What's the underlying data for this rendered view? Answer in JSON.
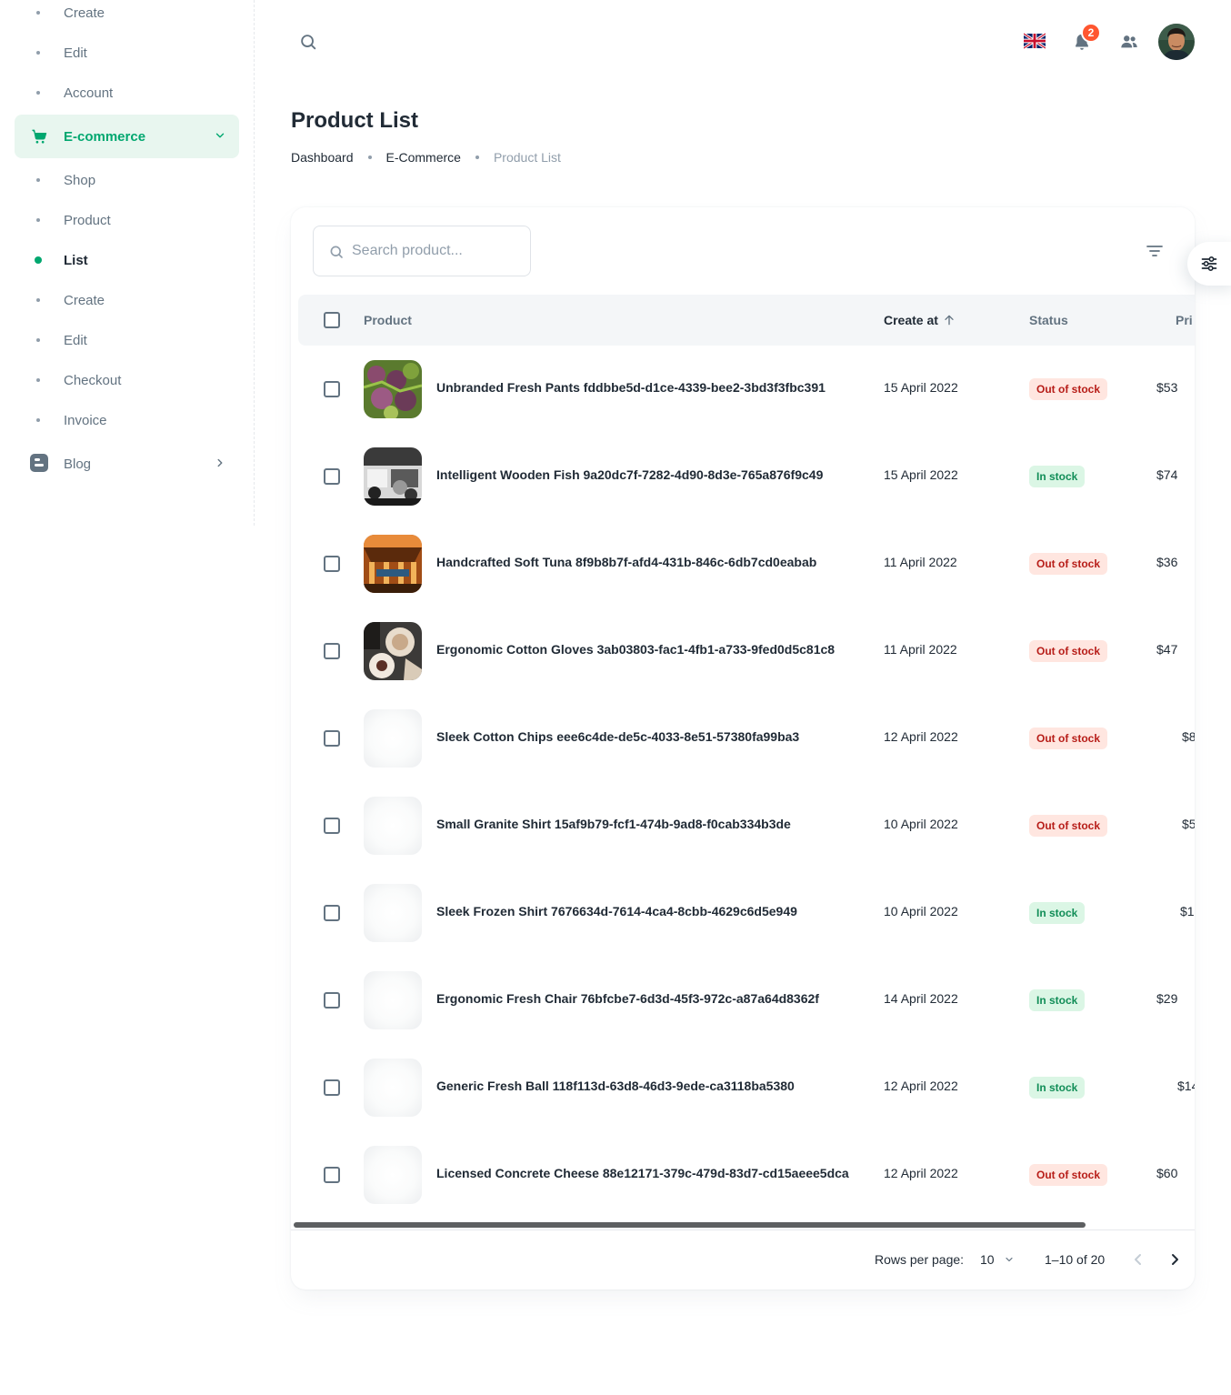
{
  "sidebar": {
    "items_top": [
      "Create",
      "Edit",
      "Account"
    ],
    "ecommerce_label": "E-commerce",
    "ecommerce_children": [
      "Shop",
      "Product",
      "List",
      "Create",
      "Edit",
      "Checkout",
      "Invoice"
    ],
    "active_child": "List",
    "blog_label": "Blog"
  },
  "header": {
    "notification_count": "2",
    "language": "English",
    "icons": [
      "search-icon",
      "uk-flag-icon",
      "bell-icon",
      "contacts-icon",
      "avatar"
    ]
  },
  "page": {
    "title": "Product List",
    "breadcrumb": [
      "Dashboard",
      "E-Commerce",
      "Product List"
    ]
  },
  "toolbar": {
    "search_placeholder": "Search product..."
  },
  "table": {
    "columns": [
      "Product",
      "Create at",
      "Status",
      "Pri"
    ],
    "rows": [
      {
        "name": "Unbranded Fresh Pants fddbbe5d-d1ce-4339-bee2-3bd3f3fbc391",
        "date": "15 April 2022",
        "status": "Out of stock",
        "price": "$53",
        "image": "photo"
      },
      {
        "name": "Intelligent Wooden Fish 9a20dc7f-7282-4d90-8d3e-765a876f9c49",
        "date": "15 April 2022",
        "status": "In stock",
        "price": "$74",
        "image": "photo"
      },
      {
        "name": "Handcrafted Soft Tuna 8f9b8b7f-afd4-431b-846c-6db7cd0eabab",
        "date": "11 April 2022",
        "status": "Out of stock",
        "price": "$36",
        "image": "photo"
      },
      {
        "name": "Ergonomic Cotton Gloves 3ab03803-fac1-4fb1-a733-9fed0d5c81c8",
        "date": "11 April 2022",
        "status": "Out of stock",
        "price": "$47",
        "image": "photo"
      },
      {
        "name": "Sleek Cotton Chips eee6c4de-de5c-4033-8e51-57380fa99ba3",
        "date": "12 April 2022",
        "status": "Out of stock",
        "price": "$8",
        "image": "blank"
      },
      {
        "name": "Small Granite Shirt 15af9b79-fcf1-474b-9ad8-f0cab334b3de",
        "date": "10 April 2022",
        "status": "Out of stock",
        "price": "$5",
        "image": "blank"
      },
      {
        "name": "Sleek Frozen Shirt 7676634d-7614-4ca4-8cbb-4629c6d5e949",
        "date": "10 April 2022",
        "status": "In stock",
        "price": "$1",
        "image": "blank"
      },
      {
        "name": "Ergonomic Fresh Chair 76bfcbe7-6d3d-45f3-972c-a87a64d8362f",
        "date": "14 April 2022",
        "status": "In stock",
        "price": "$29",
        "image": "blank"
      },
      {
        "name": "Generic Fresh Ball 118f113d-63d8-46d3-9ede-ca3118ba5380",
        "date": "12 April 2022",
        "status": "In stock",
        "price": "$14",
        "image": "blank"
      },
      {
        "name": "Licensed Concrete Cheese 88e12171-379c-479d-83d7-cd15aeee5dca",
        "date": "12 April 2022",
        "status": "Out of stock",
        "price": "$60",
        "image": "blank"
      }
    ]
  },
  "pagination": {
    "rows_per_page_label": "Rows per page:",
    "rows_per_page_value": "10",
    "range_label": "1–10 of 20"
  },
  "colors": {
    "primary": "#00a76f",
    "out_of_stock_bg": "#ffe6e0",
    "out_of_stock_text": "#b71d18",
    "in_stock_bg": "#dbf6e5",
    "in_stock_text": "#118d57",
    "notification_badge": "#ff5630"
  }
}
